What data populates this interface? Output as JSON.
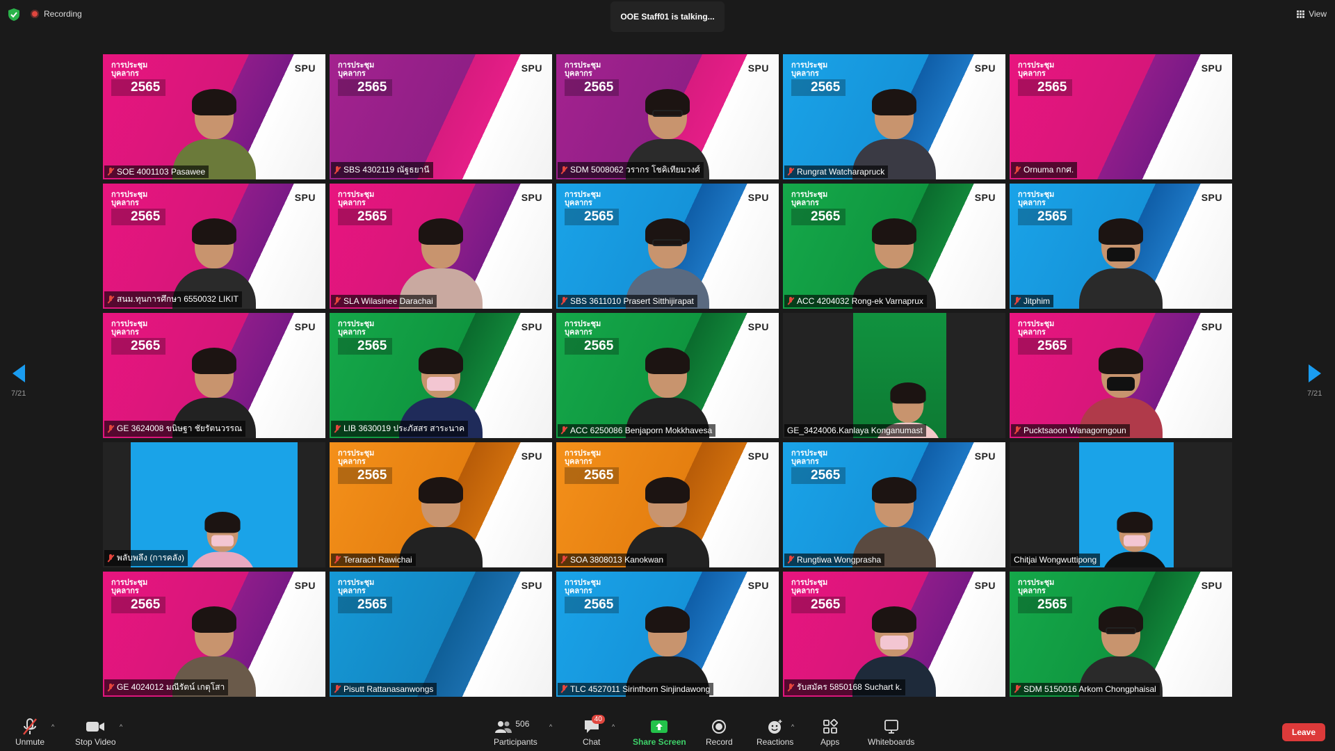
{
  "top": {
    "recording": "Recording",
    "talking": "OOE Staff01 is talking...",
    "view": "View"
  },
  "logo": {
    "title": "การประชุม บุคลากร",
    "year": "2565",
    "brand": "SPU"
  },
  "nav": {
    "page_left": "7/21",
    "page_right": "7/21"
  },
  "tiles": [
    {
      "name": "SOE 4001103 Pasawee",
      "theme": "pink",
      "muted": true
    },
    {
      "name": "SBS 4302119 ณัฐธยานี",
      "theme": "purple",
      "muted": true
    },
    {
      "name": "SDM 5008062 วรากร โชคิเทียมวงศ์",
      "theme": "purple",
      "muted": true
    },
    {
      "name": "Rungrat Watcharapruck",
      "theme": "blue",
      "muted": true
    },
    {
      "name": "Ornuma กกศ.",
      "theme": "pink",
      "muted": true
    },
    {
      "name": "สนม.ทุนการศึกษา 6550032 LIKIT",
      "theme": "pink",
      "muted": true
    },
    {
      "name": "SLA Wilasinee Darachai",
      "theme": "pink",
      "muted": true
    },
    {
      "name": "SBS 3611010 Prasert Sitthijirapat",
      "theme": "blue",
      "muted": true
    },
    {
      "name": "ACC 4204032 Rong-ek Varnaprux",
      "theme": "green",
      "muted": true
    },
    {
      "name": "Jitphim",
      "theme": "blue",
      "muted": true
    },
    {
      "name": "GE 3624008 ขนิษฐา ชัยรัตนวรรณ",
      "theme": "pink",
      "muted": true
    },
    {
      "name": "LIB 3630019 ประภัสสร สาระนาค",
      "theme": "green",
      "muted": true
    },
    {
      "name": "ACC 6250086 Benjaporn Mokkhavesa",
      "theme": "green",
      "muted": true
    },
    {
      "name": "GE_3424006.Kanlaya Konganumast",
      "theme": "dark-green",
      "muted": false
    },
    {
      "name": "Pucktsaoon Wanagorngoun",
      "theme": "pink",
      "muted": true
    },
    {
      "name": "พลับพลึง (การคลัง)",
      "theme": "dark-blue",
      "muted": true
    },
    {
      "name": "Terarach Rawichai",
      "theme": "orange",
      "muted": true
    },
    {
      "name": "SOA 3808013 Kanokwan",
      "theme": "orange",
      "muted": true
    },
    {
      "name": "Rungtiwa Wongprasha",
      "theme": "blue",
      "muted": true
    },
    {
      "name": "Chitjai Wongwuttipong",
      "theme": "dark-blue",
      "muted": false
    },
    {
      "name": "GE 4024012 มณีรัตน์ เกตุโสา",
      "theme": "pink",
      "muted": true
    },
    {
      "name": "Pisutt Rattanasanwongs",
      "theme": "teal",
      "muted": true
    },
    {
      "name": "TLC 4527011 Sirinthorn Sinjindawong",
      "theme": "blue",
      "muted": true
    },
    {
      "name": "รับสมัคร 5850168 Suchart k.",
      "theme": "pink",
      "muted": true
    },
    {
      "name": "SDM 5150016 Arkom Chongphaisal",
      "theme": "green",
      "muted": true
    }
  ],
  "toolbar": {
    "unmute": "Unmute",
    "stop_video": "Stop Video",
    "participants": "Participants",
    "participants_count": "506",
    "chat": "Chat",
    "chat_badge": "40",
    "share_screen": "Share Screen",
    "record": "Record",
    "reactions": "Reactions",
    "apps": "Apps",
    "whiteboards": "Whiteboards",
    "leave": "Leave"
  },
  "colors": {
    "accent_blue": "#1a9cf0",
    "share_green": "#23c24a",
    "leave_red": "#dd3a3a",
    "background": "#1a1a1a"
  }
}
